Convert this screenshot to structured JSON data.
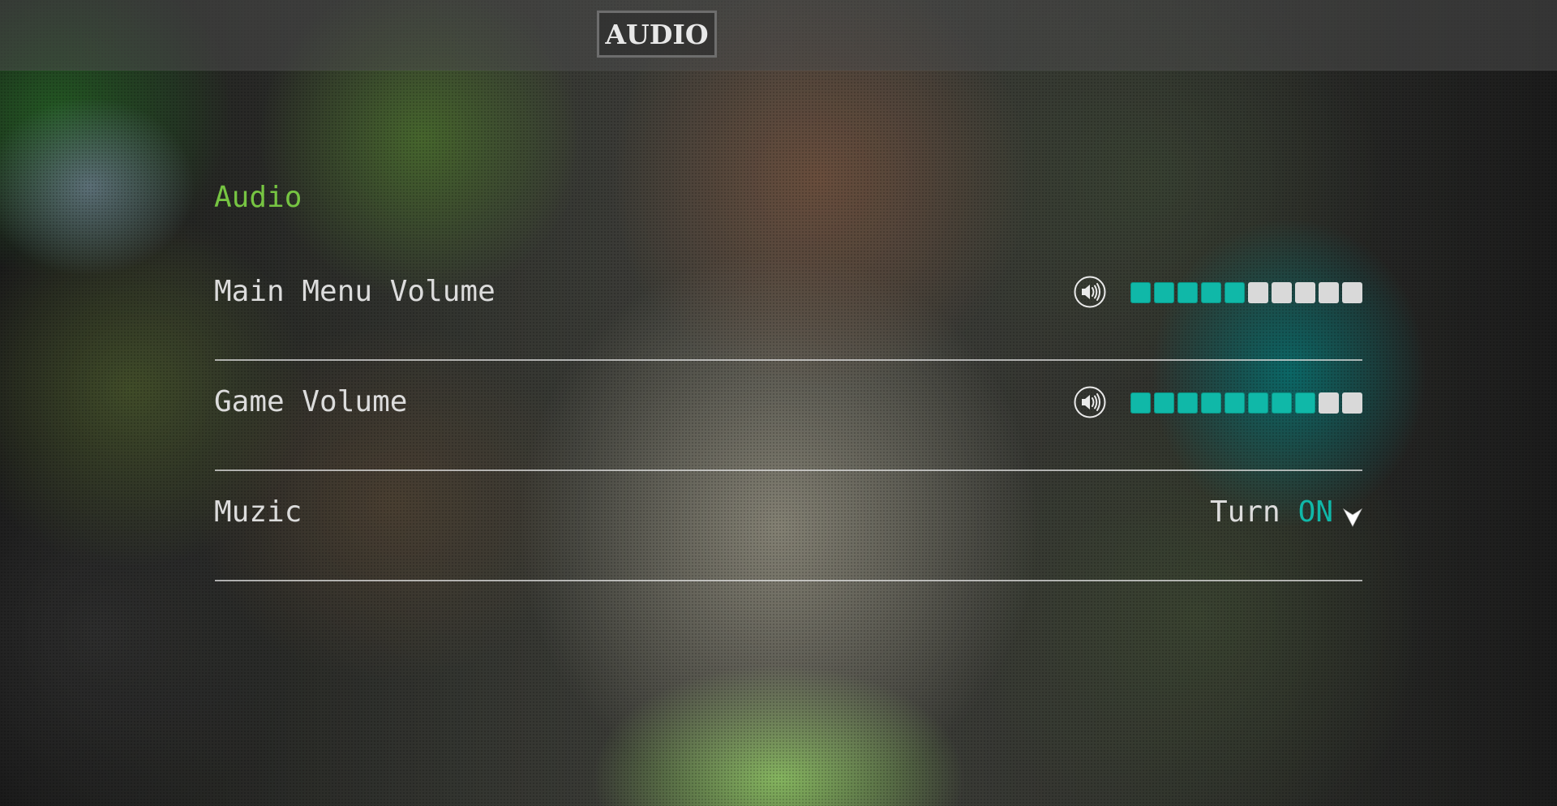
{
  "header": {
    "tab_title": "AUDIO"
  },
  "settings": {
    "section_title": "Audio",
    "main_menu_volume": {
      "label": "Main Menu Volume",
      "icon": "speaker-icon",
      "level": 5,
      "max": 10
    },
    "game_volume": {
      "label": "Game Volume",
      "icon": "speaker-icon",
      "level": 8,
      "max": 10
    },
    "music": {
      "label": "Muzic",
      "toggle_prefix": "Turn",
      "toggle_state": "ON",
      "icon": "cursor-arrow-icon"
    }
  },
  "colors": {
    "accent_green": "#76c442",
    "accent_teal": "#10b8a8",
    "text": "#dcdcdc",
    "bar_off": "#d9d9d9"
  }
}
